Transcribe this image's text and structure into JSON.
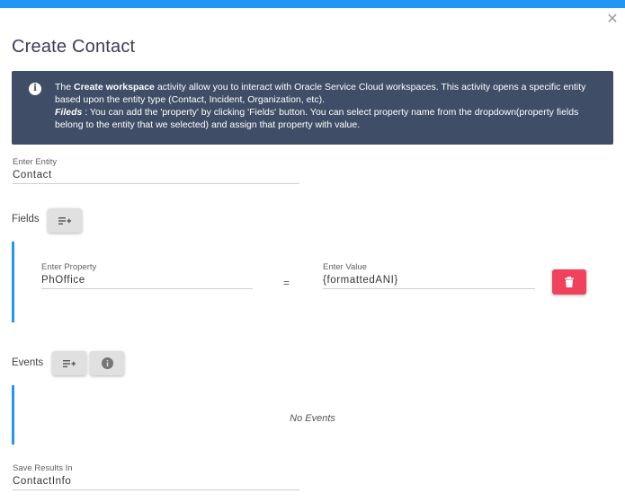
{
  "dialog": {
    "title": "Create Contact"
  },
  "info": {
    "line1_prefix": "The ",
    "line1_bold": "Create workspace",
    "line1_rest": " activity allow you to interact with Oracle Service Cloud workspaces. This activity opens a specific entity based upon the entity type (Contact, Incident, Organization, etc).",
    "line2_label": "Fileds",
    "line2_rest": " : You can add the 'property' by clicking 'Fields' button. You can select property name from the dropdown(property fields belong to the entity that we selected) and assign that property with value."
  },
  "entity": {
    "label": "Enter Entity",
    "value": "Contact"
  },
  "fields": {
    "label": "Fields",
    "rows": [
      {
        "property_label": "Enter Property",
        "property_value": "PhOffice",
        "equals": "=",
        "value_label": "Enter Value",
        "value_value": "{formattedANI}"
      }
    ]
  },
  "events": {
    "label": "Events",
    "empty_text": "No Events"
  },
  "save_results": {
    "label": "Save Results In",
    "value": "ContactInfo"
  },
  "colors": {
    "accent": "#2196f3",
    "info_bg": "#3f4e66",
    "delete": "#f0415d"
  }
}
